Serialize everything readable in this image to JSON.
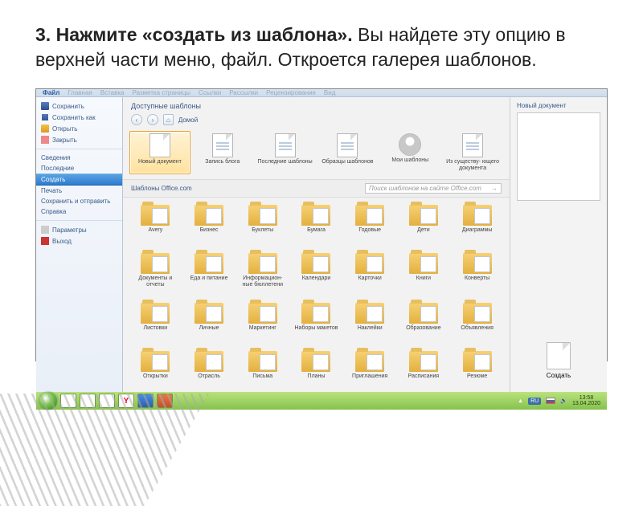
{
  "instruction": {
    "number": "3.",
    "bold": "Нажмите «создать из шаблона».",
    "rest": " Вы найдете эту опцию в верхней части меню, файл. Откроется галерея шаблонов."
  },
  "ribbon": {
    "tabs": [
      "Файл",
      "Главная",
      "Вставка",
      "Разметка страницы",
      "Ссылки",
      "Рассылки",
      "Рецензирование",
      "Вид"
    ]
  },
  "sidebar": {
    "top": [
      {
        "icon": "i-save",
        "label": "Сохранить"
      },
      {
        "icon": "i-saveas",
        "label": "Сохранить как"
      },
      {
        "icon": "i-open",
        "label": "Открыть"
      },
      {
        "icon": "i-close",
        "label": "Закрыть"
      }
    ],
    "mid": [
      {
        "label": "Сведения"
      },
      {
        "label": "Последние"
      },
      {
        "label": "Создать",
        "active": true
      },
      {
        "label": "Печать"
      },
      {
        "label": "Сохранить и отправить"
      },
      {
        "label": "Справка"
      }
    ],
    "bottom": [
      {
        "icon": "i-options",
        "label": "Параметры"
      },
      {
        "icon": "i-exit",
        "label": "Выход"
      }
    ]
  },
  "center": {
    "title": "Доступные шаблоны",
    "home": "Домой",
    "row1": [
      {
        "type": "doc",
        "label": "Новый документ",
        "selected": true
      },
      {
        "type": "doc-lines",
        "label": "Запись блога"
      },
      {
        "type": "doc-lines",
        "label": "Последние шаблоны"
      },
      {
        "type": "doc-lines",
        "label": "Образцы шаблонов"
      },
      {
        "type": "avatar",
        "label": "Мои шаблоны"
      },
      {
        "type": "doc-lines",
        "label": "Из существу-\nющего документа"
      }
    ],
    "officeLabel": "Шаблоны Office.com",
    "searchPlaceholder": "Поиск шаблонов на сайте Office.com",
    "row2": [
      {
        "label": "Avery"
      },
      {
        "label": "Бизнес"
      },
      {
        "label": "Буклеты"
      },
      {
        "label": "Бумага"
      },
      {
        "label": "Годовые"
      },
      {
        "label": "Дети"
      },
      {
        "label": "Диаграммы"
      }
    ],
    "row3": [
      {
        "label": "Документы и отчеты"
      },
      {
        "label": "Еда и питание"
      },
      {
        "label": "Информацион-\nные бюллетени"
      },
      {
        "label": "Календари"
      },
      {
        "label": "Карточки"
      },
      {
        "label": "Книги"
      },
      {
        "label": "Конверты"
      }
    ],
    "row4": [
      {
        "label": "Листовки"
      },
      {
        "label": "Личные"
      },
      {
        "label": "Маркетинг"
      },
      {
        "label": "Наборы макетов"
      },
      {
        "label": "Наклейки"
      },
      {
        "label": "Образование"
      },
      {
        "label": "Объявления"
      }
    ],
    "row5": [
      {
        "label": "Открытки"
      },
      {
        "label": "Отрасль"
      },
      {
        "label": "Письма"
      },
      {
        "label": "Планы"
      },
      {
        "label": "Приглашения"
      },
      {
        "label": "Расписания"
      },
      {
        "label": "Резюме"
      }
    ]
  },
  "right": {
    "title": "Новый документ",
    "create": "Создать"
  },
  "taskbar": {
    "lang": "RU",
    "time": "13:58",
    "date": "13.04.2020"
  }
}
